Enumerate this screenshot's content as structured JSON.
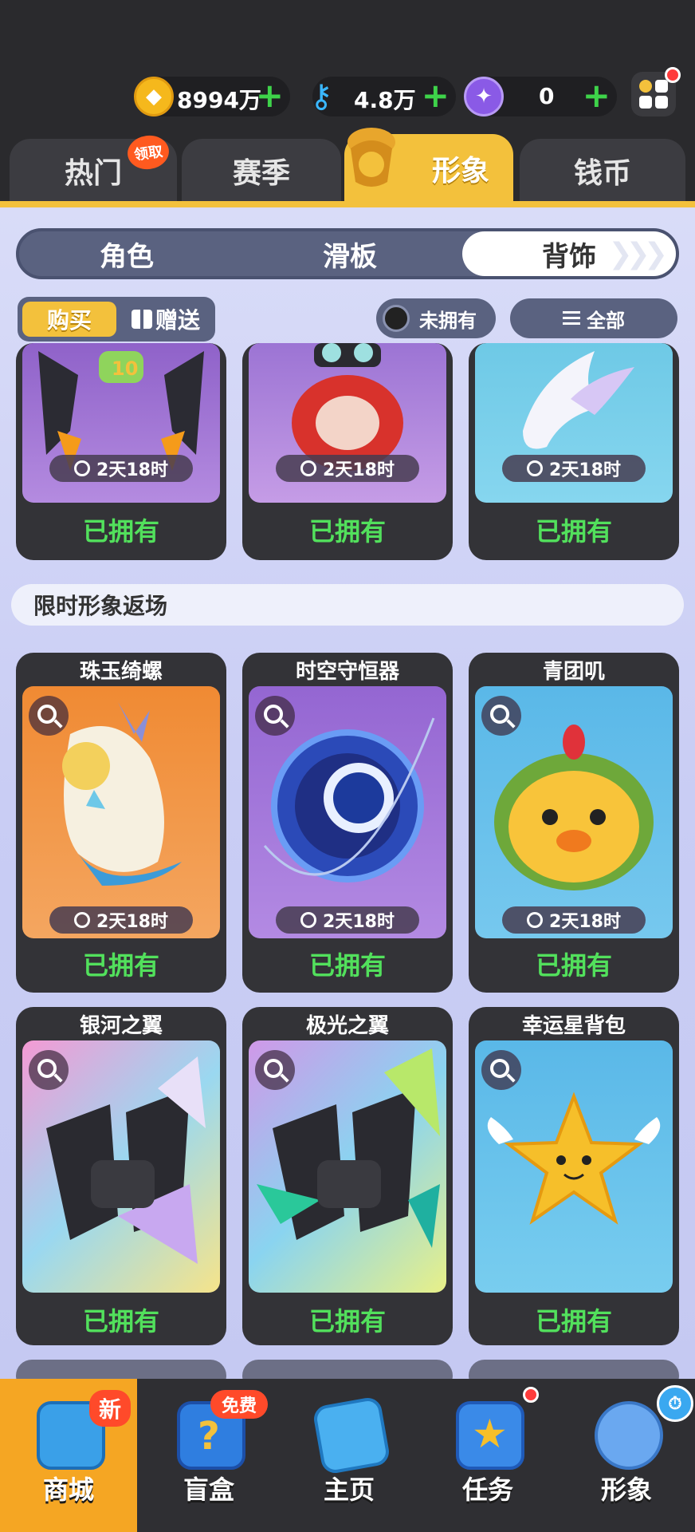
{
  "currencies": {
    "coins": "8994万",
    "keys": "4.8万",
    "gems": "0"
  },
  "main_tabs": [
    "热门",
    "赛季",
    "形象",
    "钱币"
  ],
  "main_tab_badge": "领取",
  "sub_tabs": [
    "角色",
    "滑板",
    "背饰"
  ],
  "buy_label": "购买",
  "gift_label": "赠送",
  "filter_owned": "未拥有",
  "filter_all": "全部",
  "top_cards": [
    {
      "timer": "2天18时",
      "status": "已拥有"
    },
    {
      "timer": "2天18时",
      "status": "已拥有"
    },
    {
      "timer": "2天18时",
      "status": "已拥有"
    }
  ],
  "section_title": "限时形象返场",
  "cards_row1": [
    {
      "title": "珠玉绮螺",
      "timer": "2天18时",
      "status": "已拥有"
    },
    {
      "title": "时空守恒器",
      "timer": "2天18时",
      "status": "已拥有"
    },
    {
      "title": "青团叽",
      "timer": "2天18时",
      "status": "已拥有"
    }
  ],
  "cards_row2": [
    {
      "title": "银河之翼",
      "status": "已拥有"
    },
    {
      "title": "极光之翼",
      "status": "已拥有"
    },
    {
      "title": "幸运星背包",
      "status": "已拥有"
    }
  ],
  "bottom_nav": [
    {
      "label": "商城",
      "badge": "新"
    },
    {
      "label": "盲盒",
      "badge": "免费"
    },
    {
      "label": "主页"
    },
    {
      "label": "任务"
    },
    {
      "label": "形象"
    }
  ],
  "colors": {
    "accent": "#f3c13c",
    "owned_green": "#52e05c",
    "bg_dark": "#2a2a2d"
  }
}
